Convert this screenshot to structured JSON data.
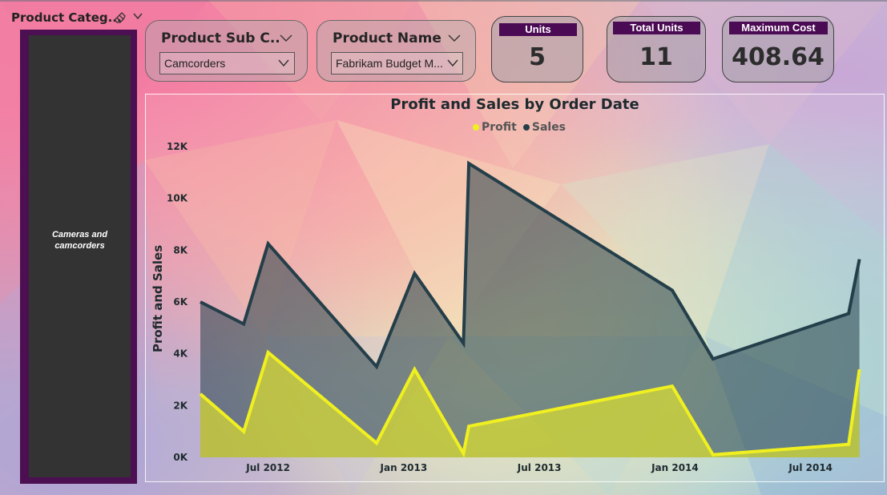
{
  "slicer": {
    "title": "Product Categ...",
    "selected_item": "Cameras and camcorders"
  },
  "dropdowns": [
    {
      "title": "Product Sub C...",
      "value": "Camcorders"
    },
    {
      "title": "Product Name",
      "value": "Fabrikam Budget M..."
    }
  ],
  "kpis": [
    {
      "label": "Units",
      "value": "5"
    },
    {
      "label": "Total Units",
      "value": "11"
    },
    {
      "label": "Maximum Cost",
      "value": "408.64"
    }
  ],
  "colors": {
    "profit": "#f0f020",
    "sales": "#243f4a",
    "accent": "#4b0a54"
  },
  "chart_data": {
    "type": "area",
    "title": "Profit and Sales by Order Date",
    "ylabel": "Profit and Sales",
    "xlabel": "",
    "legend": "top-center",
    "ylim": [
      0,
      12000
    ],
    "yticks": [
      "0K",
      "2K",
      "4K",
      "6K",
      "8K",
      "10K",
      "12K"
    ],
    "xticks": [
      {
        "label": "Jul 2012",
        "t": 2012.5
      },
      {
        "label": "Jan 2013",
        "t": 2013.0
      },
      {
        "label": "Jul 2013",
        "t": 2013.5
      },
      {
        "label": "Jan 2014",
        "t": 2014.0
      },
      {
        "label": "Jul 2014",
        "t": 2014.5
      }
    ],
    "xlim": [
      2012.25,
      2014.69
    ],
    "series": [
      {
        "name": "Sales",
        "x": [
          2012.25,
          2012.41,
          2012.5,
          2012.9,
          2013.04,
          2013.22,
          2013.24,
          2013.99,
          2014.14,
          2014.64,
          2014.68
        ],
        "y": [
          6000,
          5150,
          8250,
          3500,
          7100,
          4400,
          11350,
          6450,
          3800,
          5550,
          7650
        ]
      },
      {
        "name": "Profit",
        "x": [
          2012.25,
          2012.41,
          2012.5,
          2012.9,
          2013.04,
          2013.22,
          2013.24,
          2013.99,
          2014.14,
          2014.64,
          2014.68
        ],
        "y": [
          2450,
          1000,
          4050,
          550,
          3400,
          150,
          1200,
          2750,
          100,
          500,
          3400
        ]
      }
    ]
  }
}
